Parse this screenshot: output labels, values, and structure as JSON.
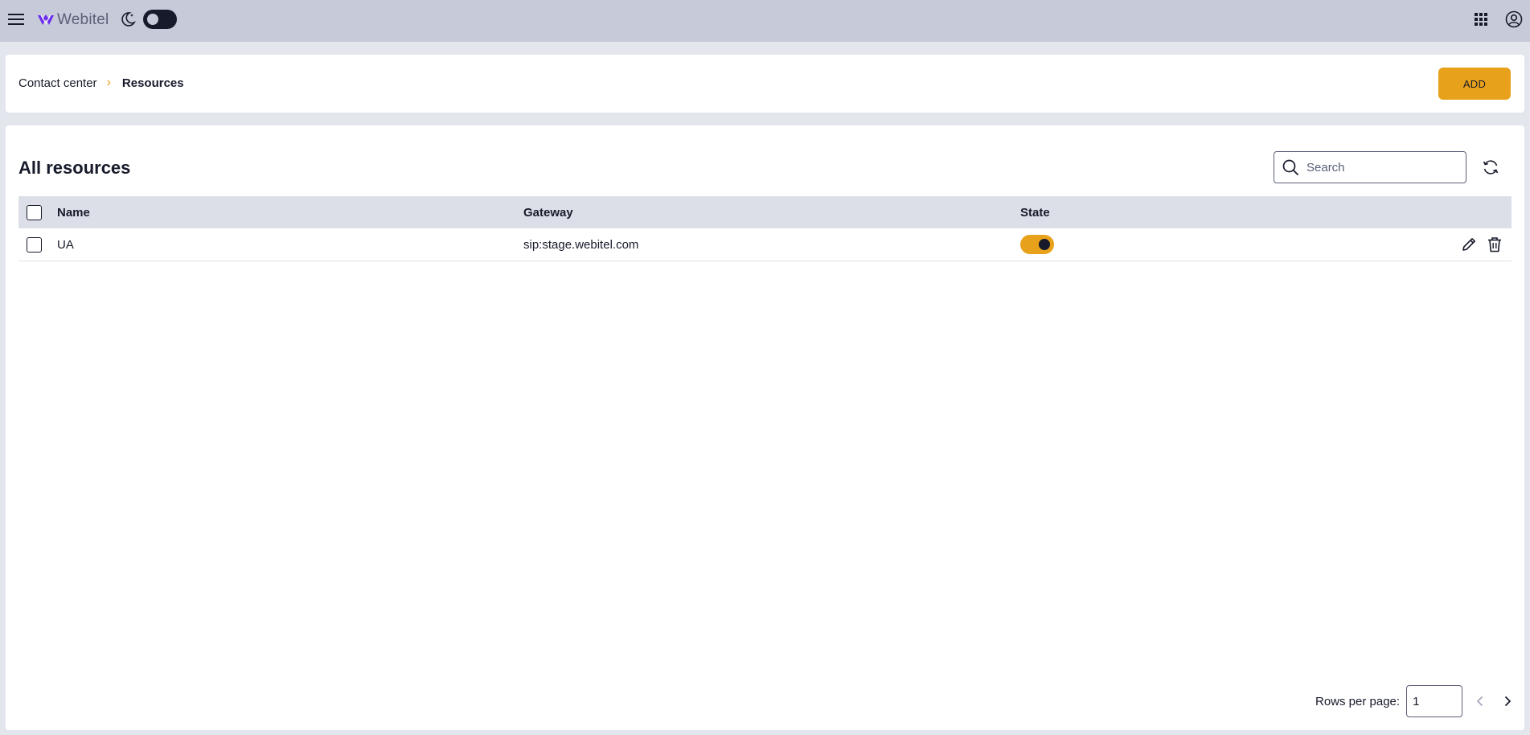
{
  "app": {
    "logo_text": "Webitel"
  },
  "breadcrumb": {
    "parent": "Contact center",
    "separator": "›",
    "current": "Resources"
  },
  "header": {
    "add_label": "ADD"
  },
  "main": {
    "title": "All resources",
    "search_placeholder": "Search"
  },
  "table": {
    "columns": [
      "Name",
      "Gateway",
      "State"
    ],
    "rows": [
      {
        "name": "UA",
        "gateway": "sip:stage.webitel.com",
        "state": true
      }
    ]
  },
  "pagination": {
    "rows_per_page_label": "Rows per page:",
    "rows_per_page_value": "1"
  },
  "colors": {
    "topbar": "#c7cad9",
    "accent": "#e8a11b",
    "dark": "#171a2a",
    "header_row": "#dcdfe8",
    "logo": "#6a2cf0"
  },
  "icons": {
    "menu": "hamburger-menu-icon",
    "theme": "moon-icon",
    "apps": "apps-grid-icon",
    "account": "account-circle-icon",
    "search": "search-icon",
    "refresh": "refresh-icon",
    "edit": "pencil-icon",
    "delete": "trash-icon",
    "prev": "chevron-left-icon",
    "next": "chevron-right-icon"
  }
}
